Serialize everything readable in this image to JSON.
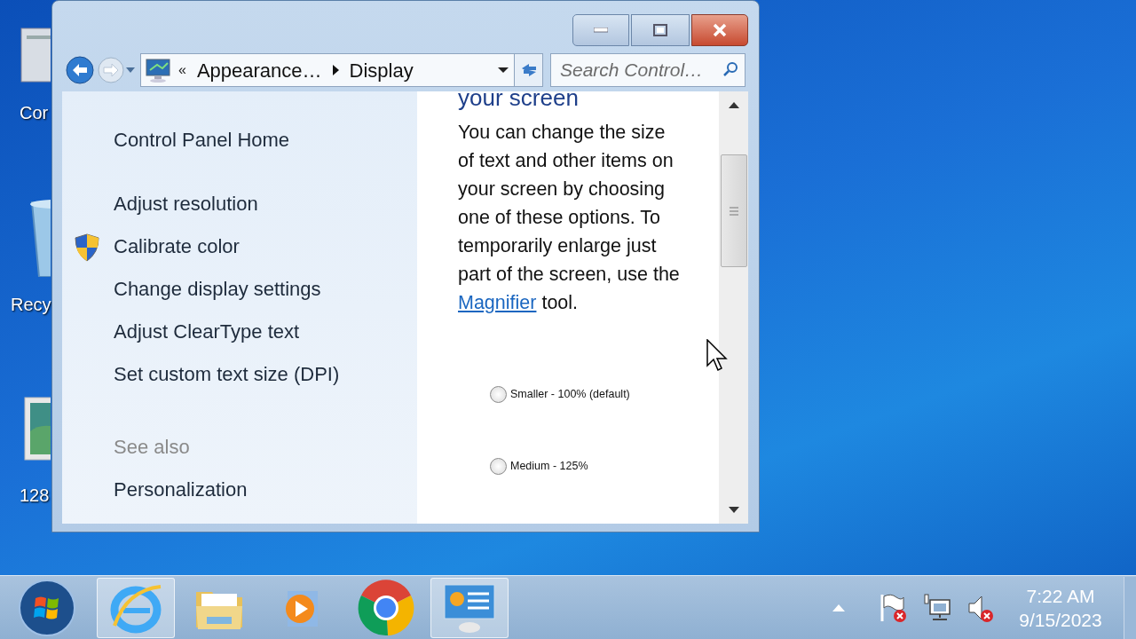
{
  "desktop_icons": [
    {
      "kind": "computer",
      "label": "Cor"
    },
    {
      "kind": "recycle",
      "label": "Recy"
    },
    {
      "kind": "image",
      "label": "128"
    }
  ],
  "window": {
    "address_bar": {
      "segments": [
        "«",
        "Appearance…",
        "Display"
      ]
    },
    "search": {
      "placeholder": "Search Control…"
    },
    "sidebar": {
      "links": [
        {
          "label": "Control Panel Home",
          "kind": "home"
        },
        {
          "label": "Adjust resolution",
          "kind": "link"
        },
        {
          "label": "Calibrate color",
          "kind": "shield"
        },
        {
          "label": "Change display settings",
          "kind": "link"
        },
        {
          "label": "Adjust ClearType text",
          "kind": "link"
        },
        {
          "label": "Set custom text size (DPI)",
          "kind": "link"
        }
      ],
      "see_also_heading": "See also",
      "see_also_links": [
        "Personalization"
      ]
    },
    "content": {
      "heading": "your screen",
      "description_before": "You can change the size of text and other items on your screen by choosing one of these options. To temporarily enlarge just part of the screen, use the",
      "description_link": "Magnifier",
      "description_after": "tool.",
      "options": [
        {
          "label": "Smaller - 100% (default)",
          "selected": false
        },
        {
          "label": "Medium - 125%",
          "selected": false
        }
      ]
    }
  },
  "taskbar": {
    "apps": [
      {
        "kind": "ie",
        "active": true
      },
      {
        "kind": "explorer",
        "active": false
      },
      {
        "kind": "media",
        "active": false
      },
      {
        "kind": "chrome",
        "active": false
      },
      {
        "kind": "control_panel",
        "active": true
      }
    ],
    "clock": {
      "time": "7:22 AM",
      "date": "9/15/2023"
    }
  }
}
